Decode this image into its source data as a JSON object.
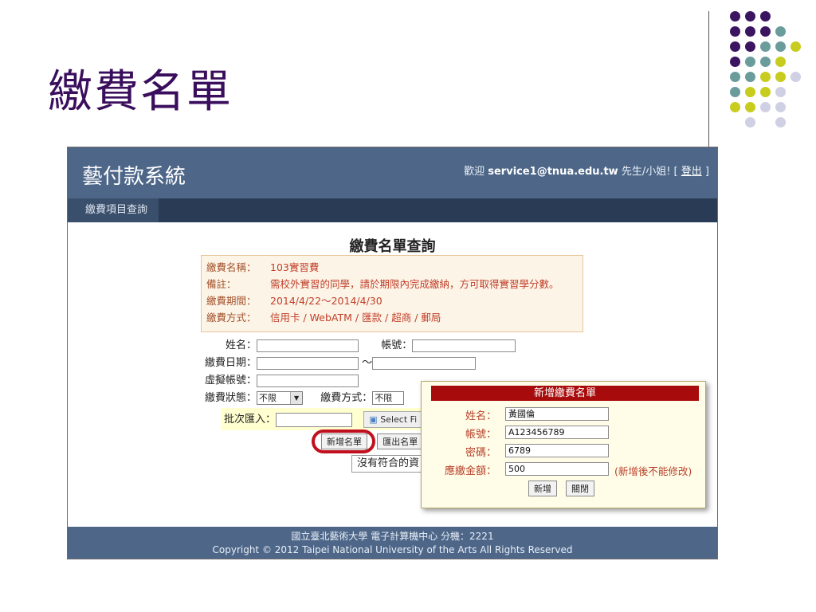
{
  "slide": {
    "title": "繳費名單"
  },
  "app": {
    "title": "藝付款系統",
    "welcome_prefix": "歡迎 ",
    "user_email": "service1@tnua.edu.tw",
    "welcome_suffix": " 先生/小姐! [ ",
    "logout": "登出",
    "welcome_end": " ]"
  },
  "nav": {
    "items": [
      "繳費項目查詢"
    ]
  },
  "page": {
    "heading": "繳費名單查詢"
  },
  "info": [
    {
      "label": "繳費名稱：",
      "value": "103實習費"
    },
    {
      "label": "備註：",
      "value": "需校外實習的同學，請於期限內完成繳納，方可取得實習學分數。"
    },
    {
      "label": "繳費期間：",
      "value": "2014/4/22～2014/4/30"
    },
    {
      "label": "繳費方式：",
      "value": "信用卡 / WebATM / 匯款 / 超商 / 郵局"
    }
  ],
  "form": {
    "name_label": "姓名：",
    "account_label": "帳號：",
    "date_label": "繳費日期：",
    "date_sep": "～",
    "virtual_label": "虛擬帳號：",
    "status_label": "繳費狀態：",
    "status_value": "不限",
    "method_label": "繳費方式：",
    "method_value": "不限",
    "batch_label": "批次匯入：",
    "select_file": "Select Fi",
    "add_button": "新增名單",
    "export_button": "匯出名單",
    "no_data": "沒有符合的資"
  },
  "modal": {
    "title": "新增繳費名單",
    "name_label": "姓名：",
    "name_value": "黃國倫",
    "account_label": "帳號：",
    "account_value": "A123456789",
    "password_label": "密碼：",
    "password_value": "6789",
    "amount_label": "應繳金額：",
    "amount_value": "500",
    "amount_note": "(新增後不能修改)",
    "add_button": "新增",
    "close_button": "關閉"
  },
  "footer": {
    "line1": "國立臺北藝術大學 電子計算機中心 分機：2221",
    "line2": "Copyright © 2012 Taipei National University of the Arts All Rights Reserved"
  },
  "colors": {
    "dot_purple": "#3b1560",
    "dot_teal": "#6b9c9c",
    "dot_yellow": "#c8cc1e",
    "dot_lavender": "#d0d0e4",
    "header_bg": "#4e6789",
    "modal_title_bg": "#a80b0b"
  }
}
